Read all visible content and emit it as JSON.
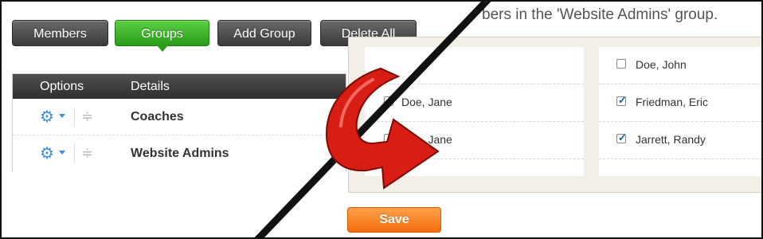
{
  "toolbar": {
    "members_label": "Members",
    "groups_label": "Groups",
    "add_group_label": "Add Group",
    "delete_all_label": "Delete All",
    "active_color": "#2a9a1a"
  },
  "table": {
    "headers": {
      "options": "Options",
      "details": "Details"
    },
    "rows": [
      {
        "name": "Coaches",
        "icon": "gear-icon"
      },
      {
        "name": "Website Admins",
        "icon": "gear-icon"
      }
    ]
  },
  "members_panel": {
    "heading": "bers in the 'Website Admins' group.",
    "left_column": [
      {
        "name": "",
        "checked": false
      },
      {
        "name": "Doe, Jane",
        "checked": false
      },
      {
        "name": "Doe, Jane",
        "checked": false
      }
    ],
    "right_column": [
      {
        "name": "Doe, John",
        "checked": false
      },
      {
        "name": "Friedman, Eric",
        "checked": true
      },
      {
        "name": "Jarrett, Randy",
        "checked": true
      }
    ],
    "save_label": "Save",
    "save_color": "#f46c0c"
  },
  "decoration": {
    "arrow_color": "#d81e14",
    "divider_color": "#111111"
  }
}
